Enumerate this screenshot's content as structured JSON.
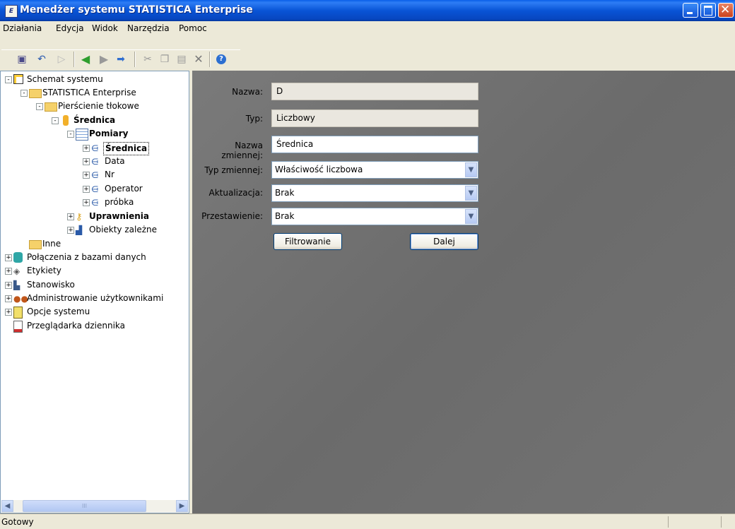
{
  "window": {
    "title": "Menedżer systemu STATISTICA Enterprise",
    "icon_text": "E"
  },
  "menu": [
    "Działania",
    "Edycja",
    "Widok",
    "Narzędzia",
    "Pomoc"
  ],
  "toolbar_icons": [
    "properties-icon",
    "undo-icon",
    "play-icon",
    "back-icon",
    "forward-icon",
    "arrow-right-icon",
    "cut-icon",
    "copy-icon",
    "paste-icon",
    "delete-icon",
    "help-icon"
  ],
  "tree": [
    {
      "label": "Schemat systemu",
      "icon": "schema-icon",
      "pm": "-"
    },
    {
      "label": "STATISTICA Enterprise",
      "icon": "folder-icon",
      "pm": "-"
    },
    {
      "label": "Pierścienie tłokowe",
      "icon": "folder-icon",
      "pm": "-"
    },
    {
      "label": "Średnica",
      "icon": "characteristic-icon",
      "pm": "-"
    },
    {
      "label": "Pomiary",
      "icon": "table-icon",
      "pm": "-"
    },
    {
      "label": "Średnica",
      "icon": "variable-icon",
      "pm": "+"
    },
    {
      "label": "Data",
      "icon": "variable-icon",
      "pm": "+"
    },
    {
      "label": "Nr",
      "icon": "variable-icon",
      "pm": "+"
    },
    {
      "label": "Operator",
      "icon": "variable-icon",
      "pm": "+"
    },
    {
      "label": "próbka",
      "icon": "variable-icon",
      "pm": "+"
    },
    {
      "label": "Uprawnienia",
      "icon": "key-icon",
      "pm": "+"
    },
    {
      "label": "Obiekty zależne",
      "icon": "dependents-icon",
      "pm": "+"
    },
    {
      "label": "Inne",
      "icon": "folder-icon",
      "pm": ""
    },
    {
      "label": "Połączenia z bazami danych",
      "icon": "database-icon",
      "pm": "+"
    },
    {
      "label": "Etykiety",
      "icon": "label-icon",
      "pm": "+"
    },
    {
      "label": "Stanowisko",
      "icon": "workstation-icon",
      "pm": "+"
    },
    {
      "label": "Administrowanie użytkownikami",
      "icon": "users-icon",
      "pm": "+"
    },
    {
      "label": "Opcje systemu",
      "icon": "options-icon",
      "pm": "+"
    },
    {
      "label": "Przeglądarka dziennika",
      "icon": "log-icon",
      "pm": ""
    }
  ],
  "form": {
    "nazwa_label": "Nazwa:",
    "nazwa_value": "D",
    "typ_label": "Typ:",
    "typ_value": "Liczbowy",
    "nazwa_zmiennej_label": "Nazwa zmiennej:",
    "nazwa_zmiennej_value": "Średnica",
    "typ_zmiennej_label": "Typ zmiennej:",
    "typ_zmiennej_value": "Właściwość liczbowa",
    "aktualizacja_label": "Aktualizacja:",
    "aktualizacja_value": "Brak",
    "przestawienie_label": "Przestawienie:",
    "przestawienie_value": "Brak",
    "filter_button": "Filtrowanie",
    "next_button": "Dalej"
  },
  "scroll_thumb": "III",
  "status": {
    "text": "Gotowy"
  },
  "colors": {
    "title_bar": "#0a5fe8",
    "panel": "#737373",
    "selection": "#000000"
  }
}
